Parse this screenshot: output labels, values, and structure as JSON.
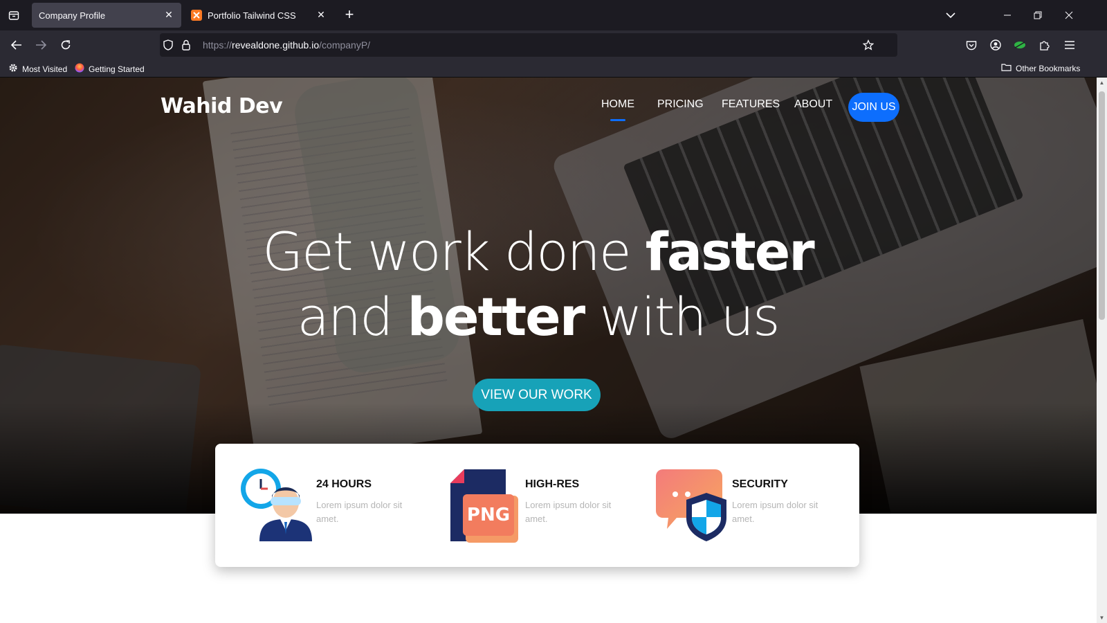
{
  "browser": {
    "tabs": [
      {
        "title": "Company Profile",
        "active": true
      },
      {
        "title": "Portfolio Tailwind CSS",
        "active": false
      }
    ],
    "new_tab_symbol": "+",
    "url": {
      "scheme": "https://",
      "host": "revealdone.github.io",
      "path": "/companyP/"
    },
    "bookmarks": [
      {
        "label": "Most Visited",
        "icon": "gear-icon"
      },
      {
        "label": "Getting Started",
        "icon": "firefox-icon"
      }
    ],
    "other_bookmarks": "Other Bookmarks"
  },
  "page": {
    "logo": "Wahid Dev",
    "nav": [
      {
        "label": "HOME",
        "active": true
      },
      {
        "label": "PRICING",
        "active": false
      },
      {
        "label": "FEATURES",
        "active": false
      },
      {
        "label": "ABOUT",
        "active": false
      }
    ],
    "join_button": "JOIN US",
    "headline": {
      "line1_light": "Get work done ",
      "line1_bold": "faster",
      "line2_light_a": "and ",
      "line2_bold": "better",
      "line2_light_b": " with us"
    },
    "cta": "VIEW OUR WORK",
    "features": [
      {
        "title": "24 HOURS",
        "desc": "Lorem ipsum dolor sit amet.",
        "icon": "support-clock-icon"
      },
      {
        "title": "HIGH-RES",
        "desc": "Lorem ipsum dolor sit amet.",
        "icon": "png-file-icon",
        "icon_text": "PNG"
      },
      {
        "title": "SECURITY",
        "desc": "Lorem ipsum dolor sit amet.",
        "icon": "security-shield-icon"
      }
    ]
  },
  "colors": {
    "primary": "#0d6efd",
    "cta": "#17a2b8",
    "chrome_dark": "#1c1b22",
    "chrome_mid": "#2b2a33"
  }
}
